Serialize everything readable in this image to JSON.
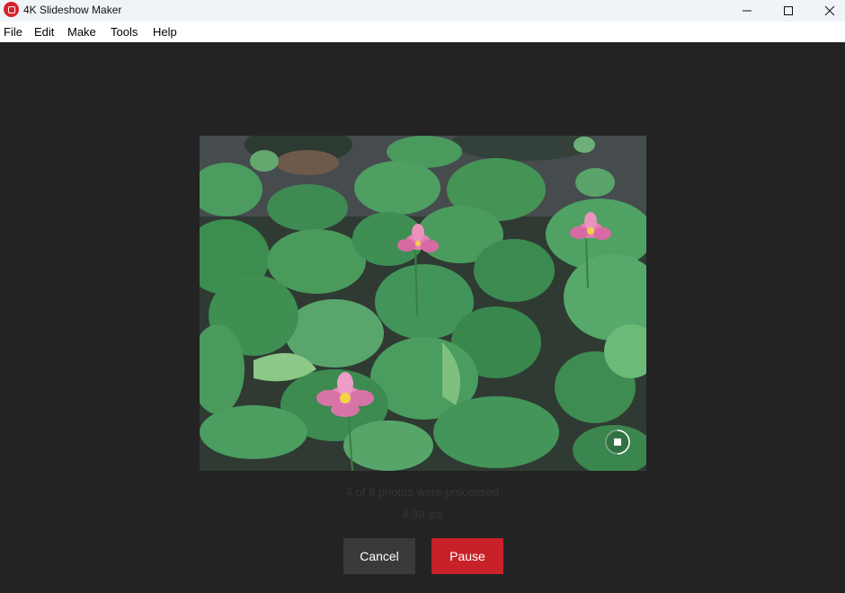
{
  "window": {
    "title": "4K Slideshow Maker",
    "icon": "app-logo-icon"
  },
  "menu": {
    "items": [
      "File",
      "Edit",
      "Make",
      "Tools",
      "Help"
    ]
  },
  "status": {
    "progress_text": "4 of 8 photos were processed",
    "speed_text": "4.99 ips"
  },
  "progress": {
    "value": 0.5
  },
  "buttons": {
    "cancel_label": "Cancel",
    "pause_label": "Pause"
  },
  "colors": {
    "accent": "#c8212a",
    "background": "#232323",
    "titlebar": "#eff4f9"
  }
}
